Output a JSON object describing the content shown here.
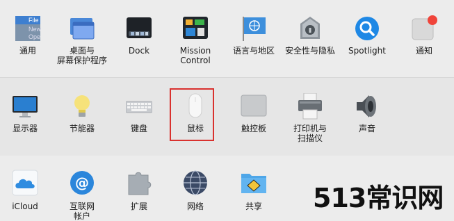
{
  "row1": {
    "panes": [
      {
        "label": "通用",
        "icon": "general-icon"
      },
      {
        "label": "桌面与\n屏幕保护程序",
        "icon": "desktop-icon"
      },
      {
        "label": "Dock",
        "icon": "dock-icon"
      },
      {
        "label": "Mission\nControl",
        "icon": "mission-control-icon"
      },
      {
        "label": "语言与地区",
        "icon": "language-region-icon"
      },
      {
        "label": "安全性与隐私",
        "icon": "security-icon"
      },
      {
        "label": "Spotlight",
        "icon": "spotlight-icon"
      },
      {
        "label": "通知",
        "icon": "notifications-icon"
      }
    ],
    "general_icon_text": [
      "File",
      "New",
      "Ope"
    ]
  },
  "row2": {
    "panes": [
      {
        "label": "显示器",
        "icon": "display-icon"
      },
      {
        "label": "节能器",
        "icon": "energy-icon"
      },
      {
        "label": "键盘",
        "icon": "keyboard-icon"
      },
      {
        "label": "鼠标",
        "icon": "mouse-icon"
      },
      {
        "label": "触控板",
        "icon": "trackpad-icon"
      },
      {
        "label": "打印机与\n扫描仪",
        "icon": "printer-icon"
      },
      {
        "label": "声音",
        "icon": "sound-icon"
      }
    ]
  },
  "row3": {
    "panes": [
      {
        "label": "iCloud",
        "icon": "icloud-icon"
      },
      {
        "label": "互联网\n帐户",
        "icon": "internet-accounts-icon"
      },
      {
        "label": "扩展",
        "icon": "extensions-icon"
      },
      {
        "label": "网络",
        "icon": "network-icon"
      },
      {
        "label": "共享",
        "icon": "sharing-icon"
      }
    ]
  },
  "watermark": "513常识网",
  "colors": {
    "highlight": "#d9312e",
    "accent_blue": "#1e88e5"
  }
}
